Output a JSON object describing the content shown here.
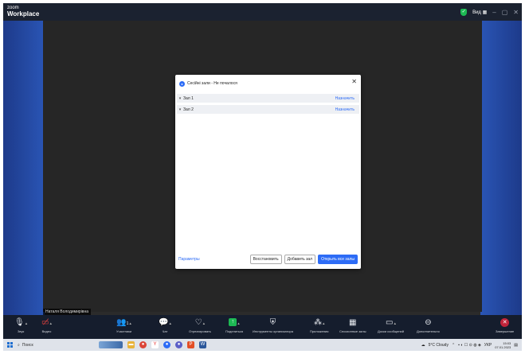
{
  "app": {
    "logo_small": "zoom",
    "logo_name": "Workplace"
  },
  "titlebar": {
    "status_label": "Вид"
  },
  "participant_name": "Наталя Володимирівна",
  "dialog": {
    "title": "Сесійні зали - Не почалося",
    "rooms": [
      {
        "name": "Зал 1",
        "action": "Назначить"
      },
      {
        "name": "Зал 2",
        "action": "Назначить"
      }
    ],
    "footer": {
      "params": "Параметры",
      "restore": "Восстановить",
      "add_room": "Добавить зал",
      "open_all": "Открыть все залы"
    }
  },
  "toolbar": {
    "audio": "Звук",
    "video": "Видео",
    "participants": "Участники",
    "participants_count": "1",
    "chat": "Чат",
    "react": "Отреагировать",
    "share": "Поделиться",
    "host_tools": "Инструменты организатора",
    "apps": "Приложения",
    "breakout": "Сессионные залы",
    "whiteboard": "Доски сообщений",
    "more": "Дополнительно",
    "end": "Завершение"
  },
  "taskbar": {
    "search_placeholder": "Поиск",
    "weather": "5°C Cloudy",
    "lang": "УКР",
    "time": "15:03",
    "date": "07.01.2023"
  },
  "colors": {
    "accent": "#2d6cf6",
    "toolbar_bg": "#151d2d",
    "end_red": "#c0243a",
    "share_green": "#1db954"
  }
}
